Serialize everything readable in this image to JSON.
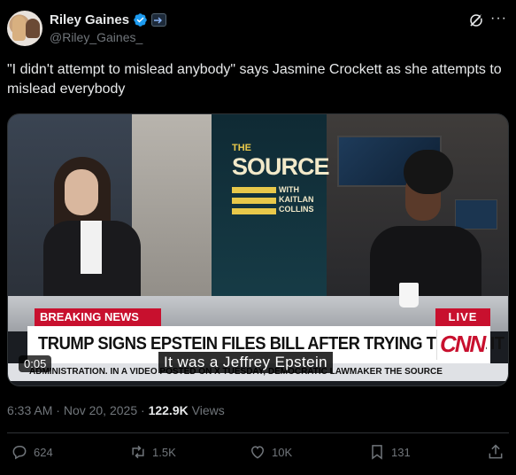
{
  "author": {
    "name": "Riley Gaines",
    "handle": "@Riley_Gaines_",
    "verified_color": "#1d9bf0"
  },
  "header_icons": [
    "grok-icon",
    "more-icon"
  ],
  "tweet": {
    "text": "\"I didn't attempt to mislead anybody\" says Jasmine Crockett as she attempts to mislead everybody"
  },
  "video": {
    "logo_the": "THE",
    "logo_source": "SOURCE",
    "logo_with": "WITH",
    "logo_host1": "KAITLAN",
    "logo_host2": "COLLINS",
    "breaking_label": "BREAKING NEWS",
    "live_label": "LIVE",
    "headline": "TRUMP SIGNS EPSTEIN FILES BILL AFTER TRYING TO KILL IT",
    "network": "CNN",
    "ticker": "ADMINISTRATION. IN A VIDEO POSTED ON X TUESDAY, DEMOCRATIC LAWMAKER THE SOURCE",
    "caption": "It was a Jeffrey Epstein",
    "timestamp": "0:05",
    "accent_color": "#c8102e"
  },
  "meta": {
    "time": "6:33 AM",
    "separator": "·",
    "date": "Nov 20, 2025",
    "views_count": "122.9K",
    "views_label": "Views"
  },
  "actions": {
    "replies": "624",
    "reposts": "1.5K",
    "likes": "10K",
    "bookmarks": "131"
  }
}
